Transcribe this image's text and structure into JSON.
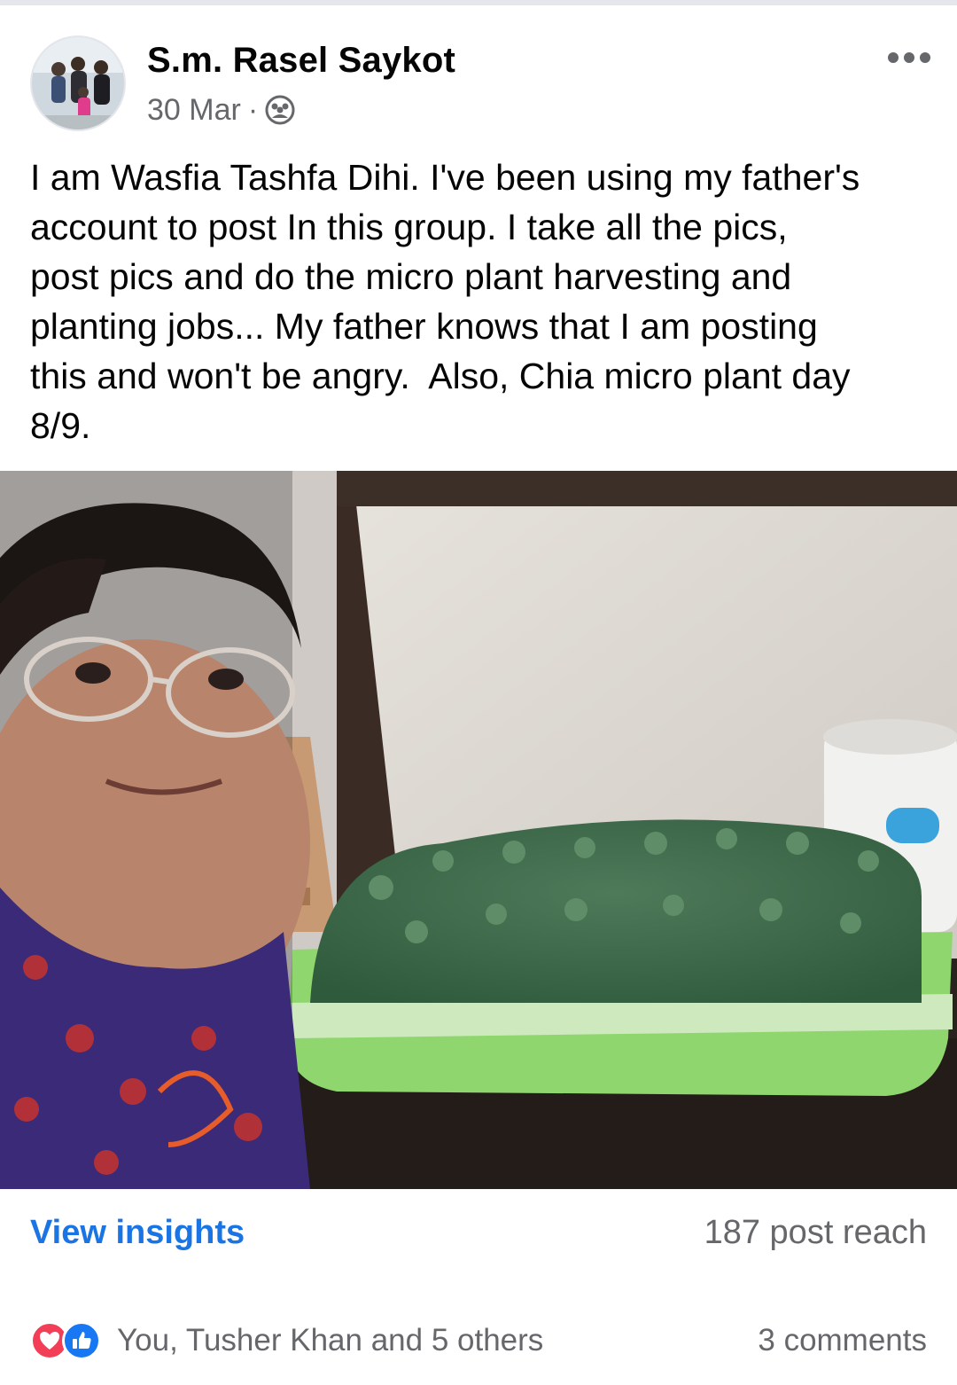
{
  "post": {
    "author": "S.m. Rasel Saykot",
    "date": "30 Mar",
    "separator": "·",
    "privacy_icon": "group-icon",
    "more_icon": "more-dots-icon",
    "text": "I am Wasfia Tashfa Dihi. I've been using my father's\naccount to post In this group. I take all the pics,\npost pics and do the micro plant harvesting and\nplanting jobs... My father knows that I am posting\nthis and won't be angry.  Also, Chia micro plant day\n8/9."
  },
  "photo": {
    "description_icon": "photo"
  },
  "insights": {
    "link_label": "View insights",
    "reach": "187 post reach"
  },
  "reactions": {
    "icons": [
      "love-reaction-icon",
      "like-reaction-icon"
    ],
    "summary": "You, Tusher Khan and 5 others",
    "comments": "3 comments"
  },
  "colors": {
    "link_blue": "#1b74e4",
    "secondary_text": "#65676b",
    "love": "#f33e58",
    "like": "#1877f2"
  }
}
